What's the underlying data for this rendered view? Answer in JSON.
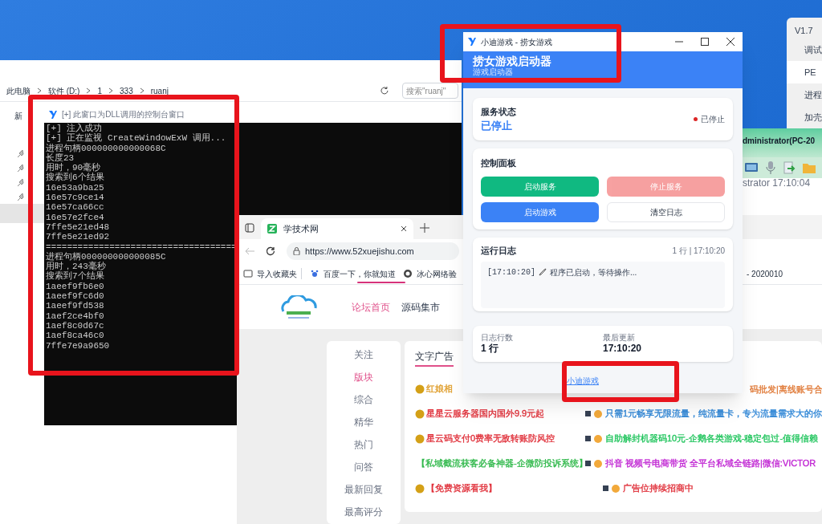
{
  "explorer": {
    "breadcrumb": [
      "此电脑",
      "软件 (D:)",
      "1",
      "333",
      "ruanj"
    ],
    "search": {
      "placeholder": "搜索\"ruanj\""
    },
    "toolbar_text": "新"
  },
  "console": {
    "title": "[+] 此窗口为DLL调用的控制台窗口",
    "lines": [
      "[+] 注入成功",
      "[+] 正在监视 CreateWindowExW 调用...",
      "进程句柄000000000000068C",
      "长度23",
      "用时，90毫秒",
      "搜索到6个结果",
      "16e53a9ba25",
      "16e57c9ce14",
      "16e57ca66cc",
      "16e57e2fce4",
      "7ffe5e21ed48",
      "7ffe5e21ed92",
      "====================================",
      "进程句柄000000000000085C",
      "用时，243毫秒",
      "搜索到7个结果",
      "1aeef9fb6e0",
      "1aeef9fc6d0",
      "1aeef9fd538",
      "1aef2ce4bf0",
      "1aef8c0d67c",
      "1aef8ca46c0",
      "7ffe7e9a9650"
    ]
  },
  "browser": {
    "tab": {
      "title": "学技术网"
    },
    "url": "https://www.52xuejishu.com",
    "bookmarks": [
      "导入收藏夹",
      "百度一下，你就知道",
      "冰心网络验"
    ],
    "bookmark_fragment": "- 2020010",
    "nav": [
      {
        "label": "论坛首页",
        "selected": true
      },
      {
        "label": "源码集市",
        "selected": false
      }
    ],
    "sidebar": [
      {
        "label": "关注",
        "selected": false
      },
      {
        "label": "版块",
        "selected": true
      },
      {
        "label": "综合",
        "selected": false
      },
      {
        "label": "精华",
        "selected": false
      },
      {
        "label": "热门",
        "selected": false
      },
      {
        "label": "问答",
        "selected": false
      },
      {
        "label": "最新回复",
        "selected": false
      },
      {
        "label": "最高评分",
        "selected": false
      }
    ],
    "ad_tab": "文字广告",
    "ad_fragment": {
      "text": "码批发|离线账号合",
      "color": "#e07b39"
    },
    "ads": [
      {
        "left": {
          "text": "红娘相",
          "color": "#e0a030"
        }
      },
      {
        "left": {
          "text": "星星云服务器国内国外9.9元起",
          "color": "#e0303a"
        },
        "right": {
          "text": "只需1元畅享无限流量，纯流量卡，专为流量需求大的你",
          "color": "#2f86d6"
        }
      },
      {
        "left": {
          "text": "星云码支付0费率无敌转账防风控",
          "color": "#e0303a"
        },
        "right": {
          "text": "自助解封机器码10元-企鹅各类游戏-稳定包过-值得信赖",
          "color": "#22c55e"
        }
      },
      {
        "left": {
          "text": "【私域截流获客必备神器-企微防投诉系统】",
          "color": "#2fb84a"
        },
        "right": {
          "text": "抖音 视频号电商带货 全平台私域全链路|微信:VICTOR",
          "color": "#c026d3"
        }
      },
      {
        "left": {
          "text": "【免费资源看我】",
          "color": "#e0303a"
        },
        "right": {
          "text": "广告位持续招商中",
          "color": "#e0303a"
        }
      }
    ]
  },
  "app": {
    "title": "小迪游戏 - 捞女游戏",
    "header": "捞女游戏启动器",
    "subtitle": "游戏启动器",
    "service": {
      "label": "服务状态",
      "state": "已停止",
      "badge": "已停止",
      "color": "#dc2626"
    },
    "control": {
      "label": "控制面板",
      "buttons": [
        {
          "label": "启动服务",
          "kind": "success",
          "disabled": false
        },
        {
          "label": "停止服务",
          "kind": "danger",
          "disabled": true
        },
        {
          "label": "启动游戏",
          "kind": "primary",
          "disabled": false
        },
        {
          "label": "清空日志",
          "kind": "default",
          "disabled": false
        }
      ]
    },
    "log": {
      "label": "运行日志",
      "summary": "1 行 | 17:10:20",
      "entries": [
        {
          "time": "[17:10:20]",
          "message": "程序已启动，等待操作..."
        }
      ]
    },
    "stats": [
      {
        "label": "日志行数",
        "value": "1 行"
      },
      {
        "label": "最后更新",
        "value": "17:10:20"
      }
    ],
    "link": "小迪游戏"
  },
  "side_window": {
    "version": "V1.7",
    "items": [
      {
        "label": "调试",
        "selected": false
      },
      {
        "label": "PE",
        "selected": true
      },
      {
        "label": "进程",
        "selected": false
      },
      {
        "label": "加壳",
        "selected": false
      }
    ]
  },
  "remote_window": {
    "title": "dministrator(PC-20",
    "status": "strator 17:10:04"
  }
}
